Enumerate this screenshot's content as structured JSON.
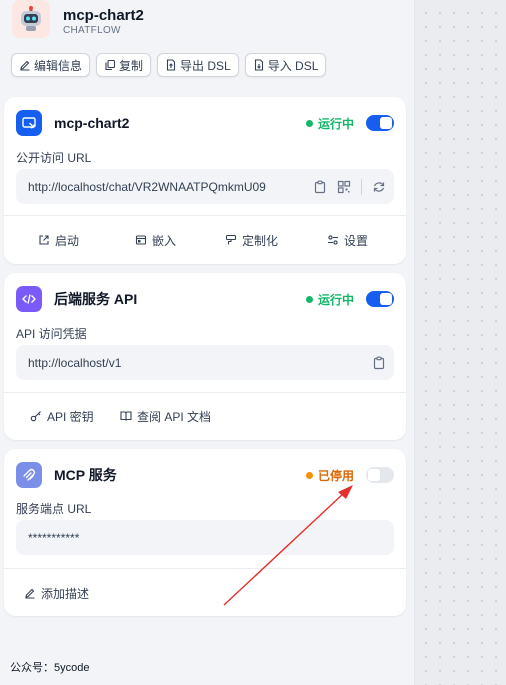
{
  "app": {
    "name": "mcp-chart2",
    "type": "CHATFLOW"
  },
  "actions": [
    {
      "label": "编辑信息",
      "icon": "edit-icon"
    },
    {
      "label": "复制",
      "icon": "copy-icon"
    },
    {
      "label": "导出 DSL",
      "icon": "export-icon"
    },
    {
      "label": "导入 DSL",
      "icon": "import-icon"
    }
  ],
  "webapp": {
    "title": "mcp-chart2",
    "status": "运行中",
    "enabled": true,
    "field_label": "公开访问 URL",
    "url": "http://localhost/chat/VR2WNAATPQmkmU09",
    "footer": [
      {
        "label": "启动",
        "icon": "launch-icon"
      },
      {
        "label": "嵌入",
        "icon": "embed-icon"
      },
      {
        "label": "定制化",
        "icon": "customize-icon"
      },
      {
        "label": "设置",
        "icon": "settings-icon"
      }
    ]
  },
  "api": {
    "title": "后端服务 API",
    "status": "运行中",
    "enabled": true,
    "field_label": "API 访问凭据",
    "url": "http://localhost/v1",
    "footer": [
      {
        "label": "API 密钥",
        "icon": "key-icon"
      },
      {
        "label": "查阅 API 文档",
        "icon": "book-icon"
      }
    ]
  },
  "mcp": {
    "title": "MCP 服务",
    "status": "已停用",
    "enabled": false,
    "field_label": "服务端点 URL",
    "url": "***********",
    "footer": [
      {
        "label": "添加描述",
        "icon": "edit-icon"
      }
    ]
  },
  "footer_note": "公众号：5ycode",
  "colors": {
    "running": "#12b76a",
    "stopped": "#f79009",
    "toggle_on": "#155eef",
    "toggle_off": "#e4e7ec",
    "annotation_arrow": "#e5302b"
  }
}
